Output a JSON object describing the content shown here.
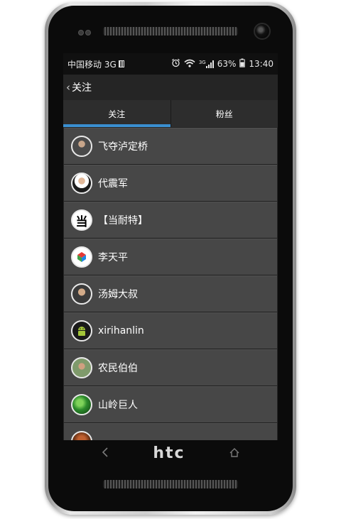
{
  "statusbar": {
    "carrier": "中国移动 3G",
    "network": "3G",
    "battery": "63%",
    "time": "13:40"
  },
  "titlebar": {
    "title": "关注"
  },
  "tabs": [
    {
      "label": "关注",
      "active": true
    },
    {
      "label": "粉丝",
      "active": false
    }
  ],
  "list": {
    "items": [
      {
        "name": "飞夺泸定桥"
      },
      {
        "name": "代震军"
      },
      {
        "name": "【当耐特】",
        "avatar_text": "当"
      },
      {
        "name": "李天平"
      },
      {
        "name": "汤姆大叔"
      },
      {
        "name": "xirihanlin"
      },
      {
        "name": "农民伯伯"
      },
      {
        "name": "山岭巨人"
      }
    ]
  },
  "device": {
    "brand": "htc"
  },
  "icons": {
    "back": "chevron-left-icon",
    "alarm": "alarm-icon",
    "wifi": "wifi-icon",
    "signal": "signal-icon",
    "battery": "battery-icon",
    "nav_back": "nav-back-icon",
    "nav_home": "nav-home-icon"
  },
  "colors": {
    "accent": "#3a8fd0",
    "list_item_bg": "#474747",
    "screen_bg": "#252525"
  }
}
